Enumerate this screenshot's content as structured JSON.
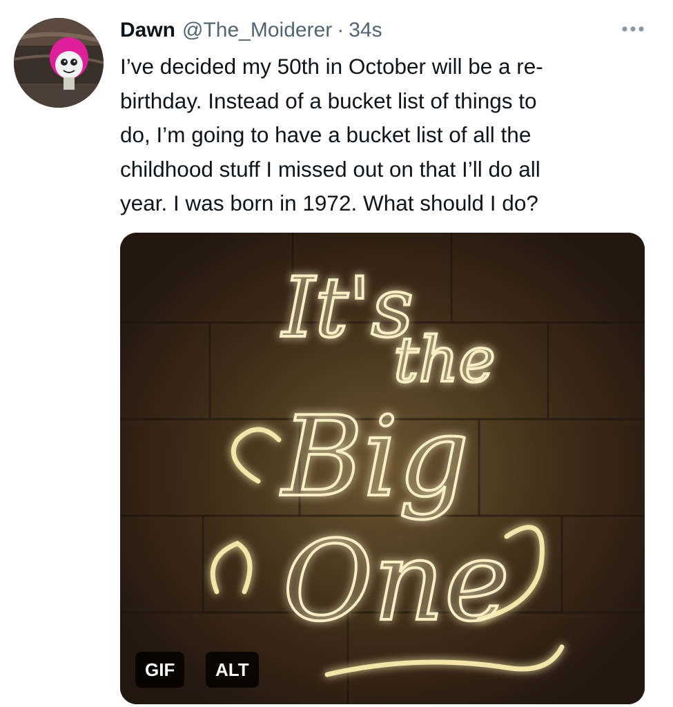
{
  "tweet": {
    "author_name": "Dawn",
    "author_handle": "@The_Moiderer",
    "separator": "·",
    "time": "34s",
    "text": "I’ve decided my 50th in October will be a re-\nbirthday. Instead of a bucket list of things to\ndo, I’m going to have a bucket list of all the\nchildhood stuff I missed out on that I’ll do all\nyear. I was born in 1972. What should I do?",
    "more_icon": "ellipsis-icon",
    "avatar_icon": "cartoon-avatar-icon"
  },
  "media": {
    "type_badge": "GIF",
    "alt_badge": "ALT",
    "neon_lines": [
      "It's",
      "the",
      "Big",
      "One"
    ],
    "neon_color": "#f3e6a8",
    "background_color": "#2e1f12"
  }
}
